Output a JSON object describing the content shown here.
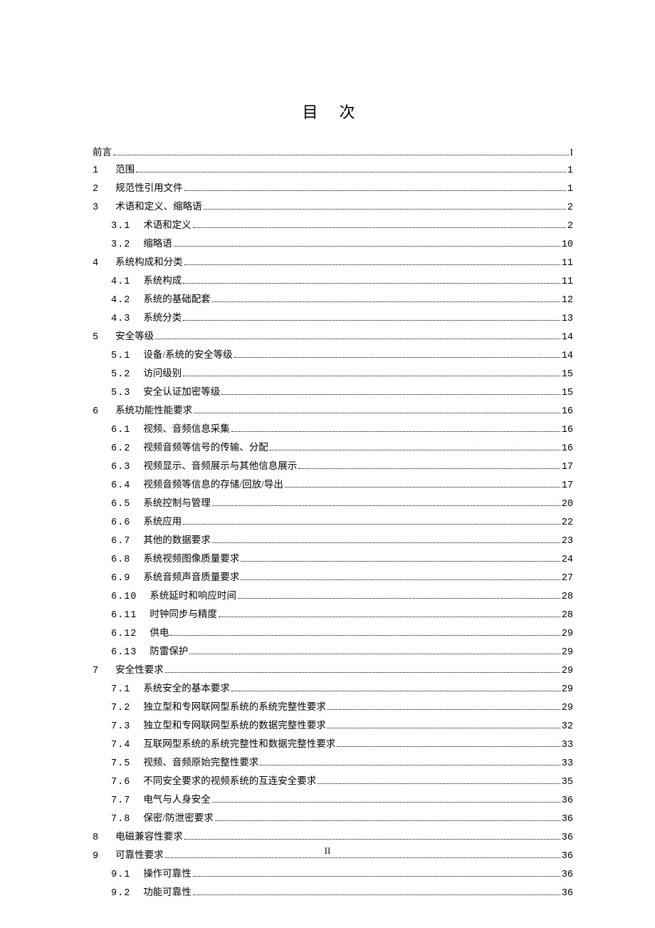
{
  "title": "目 次",
  "footer_page": "II",
  "toc": [
    {
      "level": 0,
      "num": "",
      "label": "前言",
      "page": "I",
      "roman": true
    },
    {
      "level": 0,
      "num": "1",
      "label": "范围",
      "page": "1"
    },
    {
      "level": 0,
      "num": "2",
      "label": "规范性引用文件",
      "page": "1"
    },
    {
      "level": 0,
      "num": "3",
      "label": "术语和定义、缩略语",
      "page": "2"
    },
    {
      "level": 1,
      "num": "3.1",
      "label": "术语和定义",
      "page": "2"
    },
    {
      "level": 1,
      "num": "3.2",
      "label": "缩略语",
      "page": "10"
    },
    {
      "level": 0,
      "num": "4",
      "label": "系统构成和分类",
      "page": "11"
    },
    {
      "level": 1,
      "num": "4.1",
      "label": "系统构成",
      "page": "11"
    },
    {
      "level": 1,
      "num": "4.2",
      "label": "系统的基础配套",
      "page": "12"
    },
    {
      "level": 1,
      "num": "4.3",
      "label": "系统分类",
      "page": "13"
    },
    {
      "level": 0,
      "num": "5",
      "label": "安全等级",
      "page": "14"
    },
    {
      "level": 1,
      "num": "5.1",
      "label": "设备/系统的安全等级",
      "page": "14"
    },
    {
      "level": 1,
      "num": "5.2",
      "label": "访问级别",
      "page": "15"
    },
    {
      "level": 1,
      "num": "5.3",
      "label": "安全认证加密等级",
      "page": "15"
    },
    {
      "level": 0,
      "num": "6",
      "label": "系统功能性能要求",
      "page": "16"
    },
    {
      "level": 1,
      "num": "6.1",
      "label": "视频、音频信息采集",
      "page": "16"
    },
    {
      "level": 1,
      "num": "6.2",
      "label": "视频音频等信号的传输、分配",
      "page": "16"
    },
    {
      "level": 1,
      "num": "6.3",
      "label": "视频显示、音频展示与其他信息展示",
      "page": "17"
    },
    {
      "level": 1,
      "num": "6.4",
      "label": "视频音频等信息的存储/回放/导出",
      "page": "17"
    },
    {
      "level": 1,
      "num": "6.5",
      "label": "系统控制与管理",
      "page": "20"
    },
    {
      "level": 1,
      "num": "6.6",
      "label": "系统应用",
      "page": "22"
    },
    {
      "level": 1,
      "num": "6.7",
      "label": "其他的数据要求",
      "page": "23"
    },
    {
      "level": 1,
      "num": "6.8",
      "label": "系统视频图像质量要求",
      "page": "24"
    },
    {
      "level": 1,
      "num": "6.9",
      "label": "系统音频声音质量要求",
      "page": "27"
    },
    {
      "level": 1,
      "num": "6.10",
      "label": "系统延时和响应时间",
      "page": "28",
      "wide": true
    },
    {
      "level": 1,
      "num": "6.11",
      "label": "时钟同步与精度",
      "page": "28",
      "wide": true
    },
    {
      "level": 1,
      "num": "6.12",
      "label": "供电",
      "page": "29",
      "wide": true
    },
    {
      "level": 1,
      "num": "6.13",
      "label": "防雷保护",
      "page": "29",
      "wide": true
    },
    {
      "level": 0,
      "num": "7",
      "label": "安全性要求",
      "page": "29"
    },
    {
      "level": 1,
      "num": "7.1",
      "label": "系统安全的基本要求",
      "page": "29"
    },
    {
      "level": 1,
      "num": "7.2",
      "label": "独立型和专网联网型系统的系统完整性要求",
      "page": "29"
    },
    {
      "level": 1,
      "num": "7.3",
      "label": "独立型和专网联网型系统的数据完整性要求",
      "page": "32"
    },
    {
      "level": 1,
      "num": "7.4",
      "label": "互联网型系统的系统完整性和数据完整性要求",
      "page": "33"
    },
    {
      "level": 1,
      "num": "7.5",
      "label": "视频、音频原始完整性要求",
      "page": "33"
    },
    {
      "level": 1,
      "num": "7.6",
      "label": "不同安全要求的视频系统的互连安全要求",
      "page": "35"
    },
    {
      "level": 1,
      "num": "7.7",
      "label": "电气与人身安全",
      "page": "36"
    },
    {
      "level": 1,
      "num": "7.8",
      "label": "保密/防泄密要求",
      "page": "36"
    },
    {
      "level": 0,
      "num": "8",
      "label": "电磁兼容性要求",
      "page": "36"
    },
    {
      "level": 0,
      "num": "9",
      "label": "可靠性要求",
      "page": "36"
    },
    {
      "level": 1,
      "num": "9.1",
      "label": "操作可靠性",
      "page": "36"
    },
    {
      "level": 1,
      "num": "9.2",
      "label": "功能可靠性",
      "page": "36"
    }
  ]
}
